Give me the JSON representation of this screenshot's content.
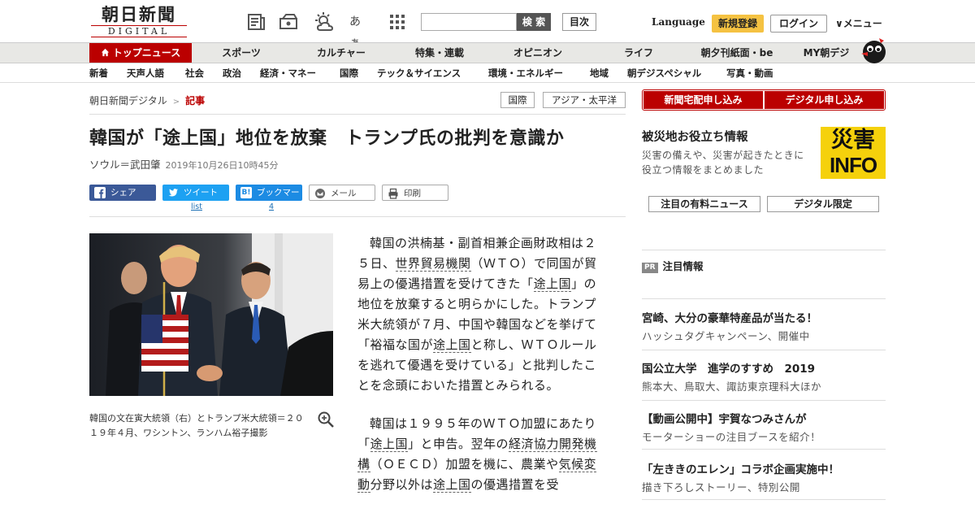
{
  "header": {
    "logo_kanji": "朝日新聞",
    "logo_sub": "DIGITAL",
    "icons": [
      "newspaper-icon",
      "megaphone-icon",
      "weather-icon",
      "font-size-icon",
      "grid-menu-icon"
    ],
    "font_size_label": "あぁ",
    "search_placeholder": "",
    "search_button": "検 索",
    "index_button": "目次",
    "language_link": "Language",
    "signup_button": "新規登録",
    "login_button": "ログイン",
    "menu_button": "∨メニュー"
  },
  "nav_main": {
    "items": [
      "トップニュース",
      "スポーツ",
      "カルチャー",
      "特集・連載",
      "オピニオン",
      "ライフ",
      "朝夕刊紙面・be",
      "MY朝デジ"
    ],
    "active_index": 0
  },
  "nav_sub": {
    "items": [
      "新着",
      "天声人語",
      "社会",
      "政治",
      "経済・マネー",
      "国際",
      "テック＆サイエンス",
      "環境・エネルギー",
      "地域",
      "朝デジスペシャル",
      "写真・動画"
    ]
  },
  "breadcrumb": {
    "home": "朝日新聞デジタル",
    "separator": ">",
    "current": "記事"
  },
  "tags": [
    "国際",
    "アジア・太平洋"
  ],
  "article": {
    "headline": "韓国が「途上国」地位を放棄　トランプ氏の批判を意識か",
    "byline": "ソウル＝武田肇",
    "date": "2019年10月26日10時45分",
    "share": {
      "facebook": "シェア",
      "twitter": "ツイート",
      "twitter_sub": "list",
      "hatena": "ブックマーク",
      "hatena_icon": "B!",
      "hatena_count": "4",
      "mail": "メール",
      "print": "印刷"
    },
    "photo_caption": "韓国の文在寅大統領（右）とトランプ米大統領＝２０１９年４月、ワシントン、ランハム裕子撮影",
    "paragraphs": [
      [
        {
          "t": "韓国の洪楠基・副首相兼企画財政相は２５日、"
        },
        {
          "t": "世界貿易機関",
          "k": true
        },
        {
          "t": "（ＷＴＯ）で同国が貿易上の優遇措置を受けてきた「"
        },
        {
          "t": "途上国",
          "k": true
        },
        {
          "t": "」の地位を放棄すると明らかにした。トランプ米大統領が７月、中国や韓国などを挙げて「裕福な国が"
        },
        {
          "t": "途上国",
          "k": true
        },
        {
          "t": "と称し、ＷＴＯルールを逃れて優遇を受けている」と批判したことを念頭においた措置とみられる。"
        }
      ],
      [
        {
          "t": "韓国は１９９５年のＷＴＯ加盟にあたり「"
        },
        {
          "t": "途上国",
          "k": true
        },
        {
          "t": "」と申告。翌年の"
        },
        {
          "t": "経済協力開発機構",
          "k": true
        },
        {
          "t": "（ＯＥＣＤ）加盟を機に、農業や"
        },
        {
          "t": "気候変動",
          "k": true
        },
        {
          "t": "分野以外は"
        },
        {
          "t": "途上国",
          "k": true
        },
        {
          "t": "の優遇措置を受"
        }
      ]
    ]
  },
  "sidebar": {
    "delivery_button": "新聞宅配申し込み",
    "digital_button": "デジタル申し込み",
    "disaster_title": "被災地お役立ち情報",
    "disaster_desc": "災害の備えや、災害が起きたときに役立つ情報をまとめました",
    "disaster_box_top": "災害",
    "disaster_box_bottom": "INFO",
    "tab_paid": "注目の有料ニュース",
    "tab_digital": "デジタル限定",
    "pr_badge": "PR",
    "pr_heading": "注目情報",
    "promos": [
      {
        "title": "宮崎、大分の豪華特産品が当たる！",
        "sub": "ハッシュタグキャンペーン、開催中"
      },
      {
        "title": "国公立大学　進学のすすめ　2019",
        "sub": "熊本大、鳥取大、諏訪東京理科大ほか"
      },
      {
        "title": "【動画公開中】宇賀なつみさんが",
        "sub": "モーターショーの注目ブースを紹介！"
      },
      {
        "title": "「左ききのエレン」コラボ企画実施中！",
        "sub": "描き下ろしストーリー、特別公開"
      }
    ]
  }
}
